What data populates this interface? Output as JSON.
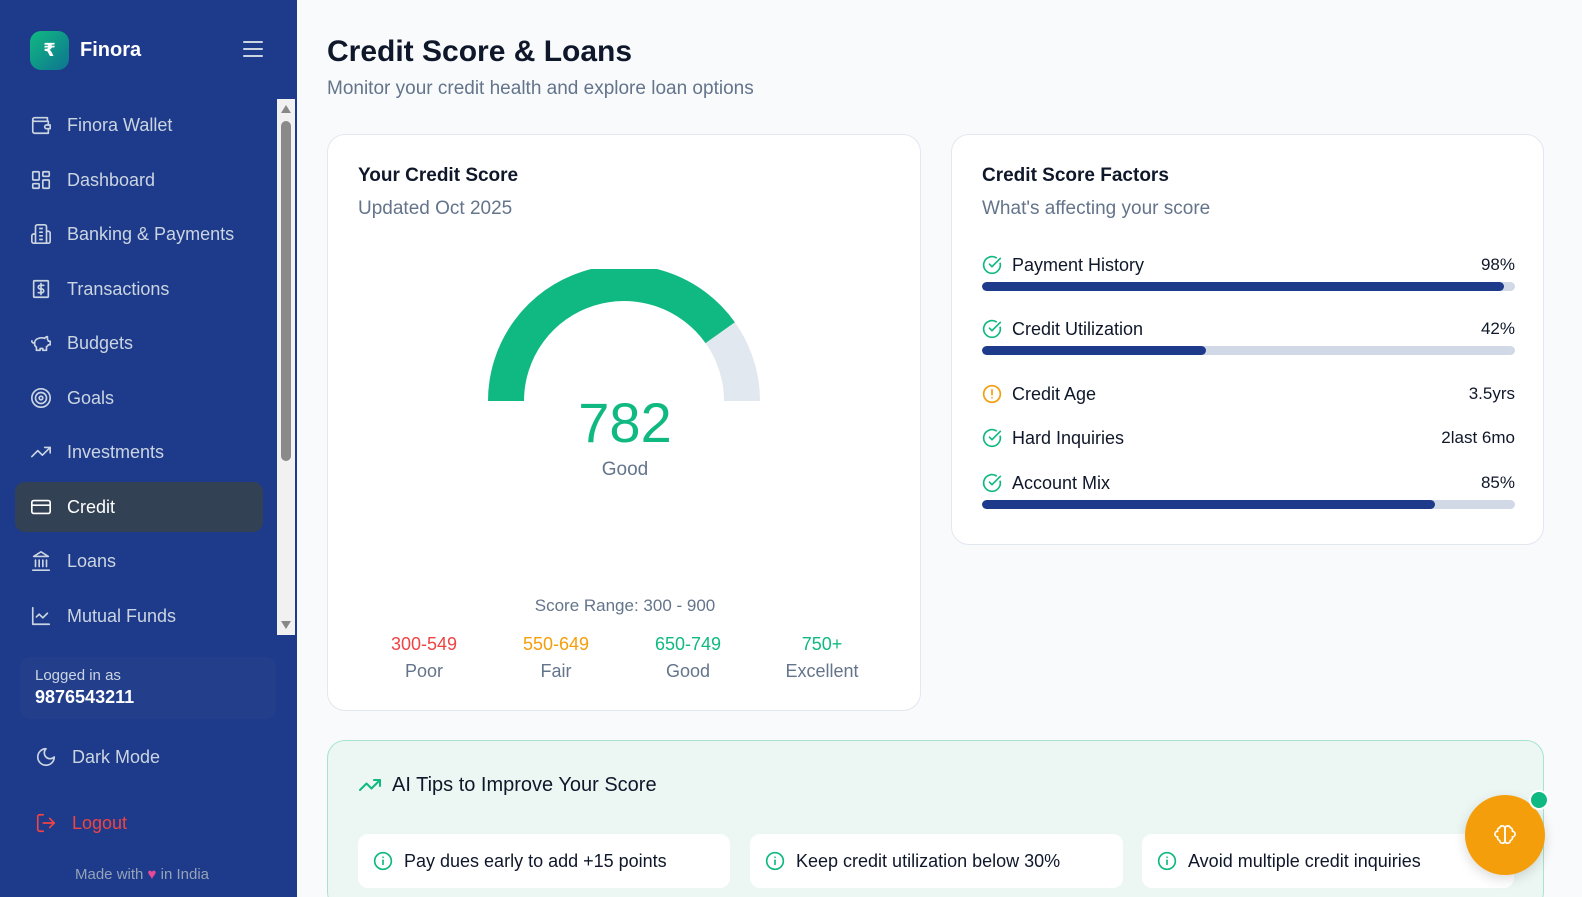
{
  "brand": {
    "logo_symbol": "₹",
    "name": "Finora"
  },
  "sidebar": {
    "items": [
      {
        "label": "Finora Wallet",
        "icon": "wallet-icon"
      },
      {
        "label": "Dashboard",
        "icon": "dashboard-icon"
      },
      {
        "label": "Banking & Payments",
        "icon": "bank-icon"
      },
      {
        "label": "Transactions",
        "icon": "receipt-icon"
      },
      {
        "label": "Budgets",
        "icon": "piggy-bank-icon"
      },
      {
        "label": "Goals",
        "icon": "target-icon"
      },
      {
        "label": "Investments",
        "icon": "trending-up-icon"
      },
      {
        "label": "Credit",
        "icon": "credit-card-icon",
        "active": true
      },
      {
        "label": "Loans",
        "icon": "landmark-icon"
      },
      {
        "label": "Mutual Funds",
        "icon": "line-chart-icon"
      }
    ],
    "user": {
      "label": "Logged in as",
      "phone": "9876543211"
    },
    "dark_mode_label": "Dark Mode",
    "logout_label": "Logout",
    "footer": {
      "prefix": "Made with",
      "heart": "♥",
      "suffix": "in India"
    }
  },
  "header": {
    "title": "Credit Score & Loans",
    "subtitle": "Monitor your credit health and explore loan options"
  },
  "score_card": {
    "title": "Your Credit Score",
    "updated": "Updated Oct 2025",
    "score": "782",
    "rating": "Good",
    "range_text": "Score Range: 300 - 900",
    "score_min": 300,
    "score_max": 900,
    "score_value": 782,
    "gauge_color": "#10b981",
    "gauge_track_color": "#e2e8f0",
    "ranges": [
      {
        "range": "300-549",
        "label": "Poor",
        "color": "#ef4444"
      },
      {
        "range": "550-649",
        "label": "Fair",
        "color": "#f59e0b"
      },
      {
        "range": "650-749",
        "label": "Good",
        "color": "#10b981"
      },
      {
        "range": "750+",
        "label": "Excellent",
        "color": "#10b981"
      }
    ]
  },
  "factors_card": {
    "title": "Credit Score Factors",
    "subtitle": "What's affecting your score",
    "factors": [
      {
        "name": "Payment History",
        "value": "98%",
        "status": "good",
        "fill": 0.98
      },
      {
        "name": "Credit Utilization",
        "value": "42%",
        "status": "good",
        "fill": 0.42
      },
      {
        "name": "Credit Age",
        "value": "3.5yrs",
        "status": "warning"
      },
      {
        "name": "Hard Inquiries",
        "value": "2last 6mo",
        "status": "good"
      },
      {
        "name": "Account Mix",
        "value": "85%",
        "status": "good",
        "fill": 0.85
      }
    ]
  },
  "tips": {
    "title": "AI Tips to Improve Your Score",
    "items": [
      "Pay dues early to add +15 points",
      "Keep credit utilization below 30%",
      "Avoid multiple credit inquiries"
    ]
  },
  "colors": {
    "primary": "#1e3a8a",
    "success": "#10b981",
    "warning": "#f59e0b",
    "danger": "#ef4444"
  }
}
